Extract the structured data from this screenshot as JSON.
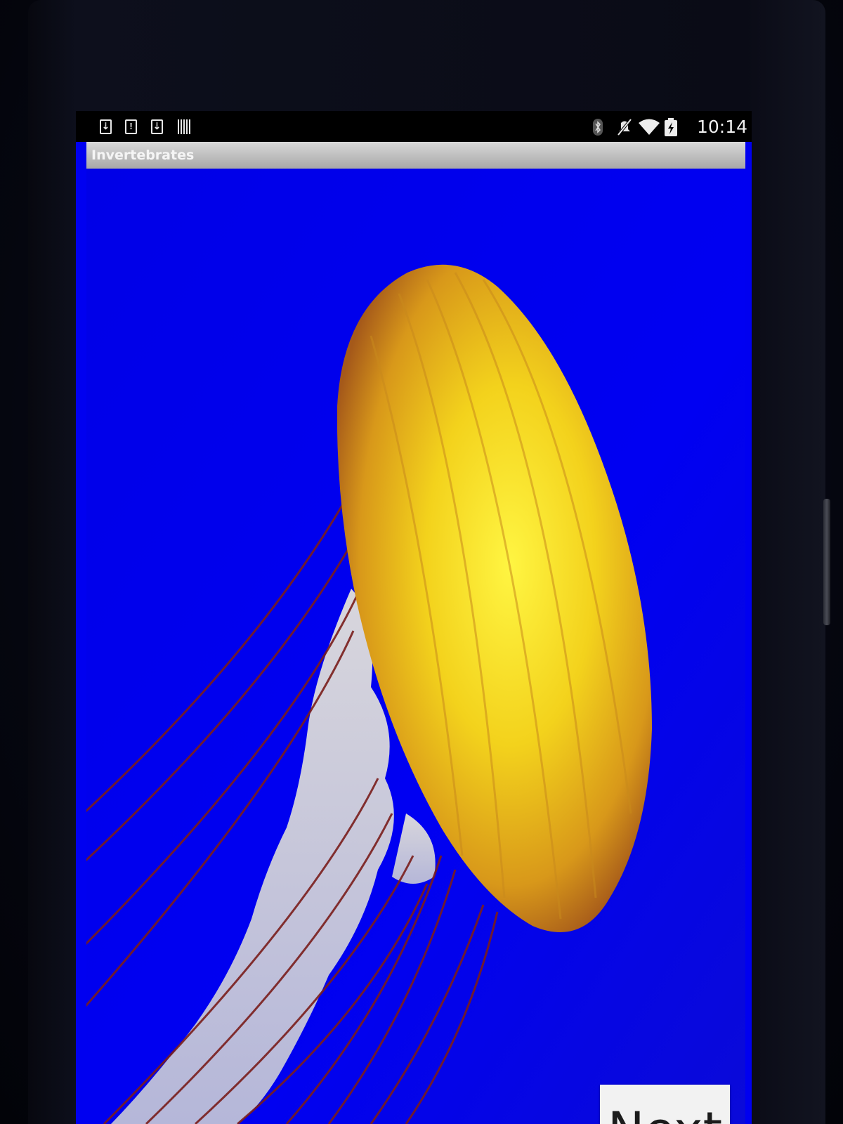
{
  "status_bar": {
    "notification_icons": [
      "download-icon",
      "alert-icon",
      "download-icon",
      "barcode-icon"
    ],
    "notification_glyphs": [
      "⇣",
      "!",
      "⇣"
    ],
    "system_icons": [
      "bluetooth-icon",
      "mute-icon",
      "wifi-icon",
      "battery-charging-icon"
    ],
    "time": "10:14"
  },
  "action_bar": {
    "title": "Invertebrates"
  },
  "content": {
    "image_subject": "jellyfish",
    "background_color": "#0000ee",
    "next_label": "Next"
  },
  "colors": {
    "screen_blue": "#0000ee",
    "action_bar": "#b8b8b8",
    "jelly_bell": "#f1c51a",
    "tentacles": "#7a1e1c"
  }
}
